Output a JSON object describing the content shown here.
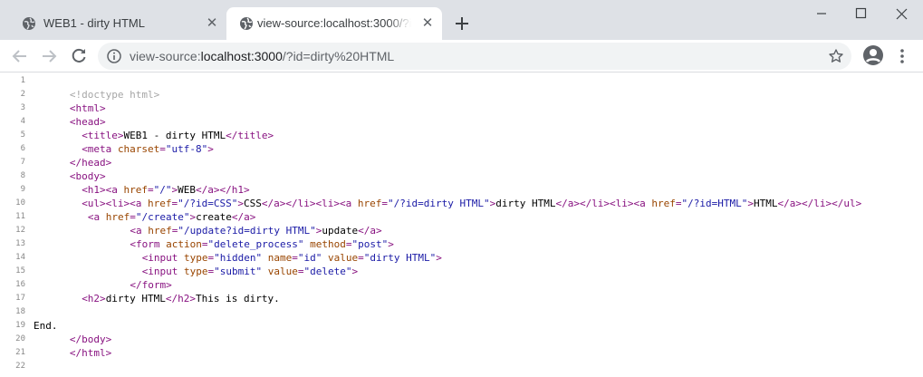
{
  "tabs": [
    {
      "title": "WEB1 - dirty HTML",
      "active": false
    },
    {
      "title": "view-source:localhost:3000/?id=dirty HTML",
      "active": true
    }
  ],
  "url": {
    "scheme": "view-source:",
    "host": "localhost:3000",
    "path": "/?id=dirty%20HTML"
  },
  "source_lines": [
    {
      "num": "1",
      "indent": 0,
      "parts": []
    },
    {
      "num": "2",
      "indent": 6,
      "parts": [
        {
          "t": "comment",
          "v": "<!doctype html>"
        }
      ]
    },
    {
      "num": "3",
      "indent": 6,
      "parts": [
        {
          "t": "tag",
          "v": "<html>"
        }
      ]
    },
    {
      "num": "4",
      "indent": 6,
      "parts": [
        {
          "t": "tag",
          "v": "<head>"
        }
      ]
    },
    {
      "num": "5",
      "indent": 8,
      "parts": [
        {
          "t": "tag",
          "v": "<title>"
        },
        {
          "t": "text",
          "v": "WEB1 - dirty HTML"
        },
        {
          "t": "tag",
          "v": "</title>"
        }
      ]
    },
    {
      "num": "6",
      "indent": 8,
      "parts": [
        {
          "t": "tag",
          "v": "<meta "
        },
        {
          "t": "attr",
          "v": "charset"
        },
        {
          "t": "tag",
          "v": "="
        },
        {
          "t": "val",
          "v": "\"utf-8\""
        },
        {
          "t": "tag",
          "v": ">"
        }
      ]
    },
    {
      "num": "7",
      "indent": 6,
      "parts": [
        {
          "t": "tag",
          "v": "</head>"
        }
      ]
    },
    {
      "num": "8",
      "indent": 6,
      "parts": [
        {
          "t": "tag",
          "v": "<body>"
        }
      ]
    },
    {
      "num": "9",
      "indent": 8,
      "parts": [
        {
          "t": "tag",
          "v": "<h1><a "
        },
        {
          "t": "attr",
          "v": "href"
        },
        {
          "t": "tag",
          "v": "="
        },
        {
          "t": "val",
          "v": "\"/\""
        },
        {
          "t": "tag",
          "v": ">"
        },
        {
          "t": "text",
          "v": "WEB"
        },
        {
          "t": "tag",
          "v": "</a></h1>"
        }
      ]
    },
    {
      "num": "10",
      "indent": 8,
      "parts": [
        {
          "t": "tag",
          "v": "<ul><li><a "
        },
        {
          "t": "attr",
          "v": "href"
        },
        {
          "t": "tag",
          "v": "="
        },
        {
          "t": "val",
          "v": "\"/?id=CSS\""
        },
        {
          "t": "tag",
          "v": ">"
        },
        {
          "t": "text",
          "v": "CSS"
        },
        {
          "t": "tag",
          "v": "</a></li><li><a "
        },
        {
          "t": "attr",
          "v": "href"
        },
        {
          "t": "tag",
          "v": "="
        },
        {
          "t": "val",
          "v": "\"/?id=dirty HTML\""
        },
        {
          "t": "tag",
          "v": ">"
        },
        {
          "t": "text",
          "v": "dirty HTML"
        },
        {
          "t": "tag",
          "v": "</a></li><li><a "
        },
        {
          "t": "attr",
          "v": "href"
        },
        {
          "t": "tag",
          "v": "="
        },
        {
          "t": "val",
          "v": "\"/?id=HTML\""
        },
        {
          "t": "tag",
          "v": ">"
        },
        {
          "t": "text",
          "v": "HTML"
        },
        {
          "t": "tag",
          "v": "</a></li></ul>"
        }
      ]
    },
    {
      "num": "11",
      "indent": 9,
      "parts": [
        {
          "t": "tag",
          "v": "<a "
        },
        {
          "t": "attr",
          "v": "href"
        },
        {
          "t": "tag",
          "v": "="
        },
        {
          "t": "val",
          "v": "\"/create\""
        },
        {
          "t": "tag",
          "v": ">"
        },
        {
          "t": "text",
          "v": "create"
        },
        {
          "t": "tag",
          "v": "</a>"
        }
      ]
    },
    {
      "num": "12",
      "indent": 16,
      "parts": [
        {
          "t": "tag",
          "v": "<a "
        },
        {
          "t": "attr",
          "v": "href"
        },
        {
          "t": "tag",
          "v": "="
        },
        {
          "t": "val",
          "v": "\"/update?id=dirty HTML\""
        },
        {
          "t": "tag",
          "v": ">"
        },
        {
          "t": "text",
          "v": "update"
        },
        {
          "t": "tag",
          "v": "</a>"
        }
      ]
    },
    {
      "num": "13",
      "indent": 16,
      "parts": [
        {
          "t": "tag",
          "v": "<form "
        },
        {
          "t": "attr",
          "v": "action"
        },
        {
          "t": "tag",
          "v": "="
        },
        {
          "t": "val",
          "v": "\"delete_process\""
        },
        {
          "t": "tag",
          "v": " "
        },
        {
          "t": "attr",
          "v": "method"
        },
        {
          "t": "tag",
          "v": "="
        },
        {
          "t": "val",
          "v": "\"post\""
        },
        {
          "t": "tag",
          "v": ">"
        }
      ]
    },
    {
      "num": "14",
      "indent": 18,
      "parts": [
        {
          "t": "tag",
          "v": "<input "
        },
        {
          "t": "attr",
          "v": "type"
        },
        {
          "t": "tag",
          "v": "="
        },
        {
          "t": "val",
          "v": "\"hidden\""
        },
        {
          "t": "tag",
          "v": " "
        },
        {
          "t": "attr",
          "v": "name"
        },
        {
          "t": "tag",
          "v": "="
        },
        {
          "t": "val",
          "v": "\"id\""
        },
        {
          "t": "tag",
          "v": " "
        },
        {
          "t": "attr",
          "v": "value"
        },
        {
          "t": "tag",
          "v": "="
        },
        {
          "t": "val",
          "v": "\"dirty HTML\""
        },
        {
          "t": "tag",
          "v": ">"
        }
      ]
    },
    {
      "num": "15",
      "indent": 18,
      "parts": [
        {
          "t": "tag",
          "v": "<input "
        },
        {
          "t": "attr",
          "v": "type"
        },
        {
          "t": "tag",
          "v": "="
        },
        {
          "t": "val",
          "v": "\"submit\""
        },
        {
          "t": "tag",
          "v": " "
        },
        {
          "t": "attr",
          "v": "value"
        },
        {
          "t": "tag",
          "v": "="
        },
        {
          "t": "val",
          "v": "\"delete\""
        },
        {
          "t": "tag",
          "v": ">"
        }
      ]
    },
    {
      "num": "16",
      "indent": 16,
      "parts": [
        {
          "t": "tag",
          "v": "</form>"
        }
      ]
    },
    {
      "num": "17",
      "indent": 8,
      "parts": [
        {
          "t": "tag",
          "v": "<h2>"
        },
        {
          "t": "text",
          "v": "dirty HTML"
        },
        {
          "t": "tag",
          "v": "</h2>"
        },
        {
          "t": "text",
          "v": "This is dirty."
        }
      ]
    },
    {
      "num": "18",
      "indent": 0,
      "parts": []
    },
    {
      "num": "19",
      "indent": 0,
      "parts": [
        {
          "t": "text",
          "v": "End."
        }
      ]
    },
    {
      "num": "20",
      "indent": 6,
      "parts": [
        {
          "t": "tag",
          "v": "</body>"
        }
      ]
    },
    {
      "num": "21",
      "indent": 6,
      "parts": [
        {
          "t": "tag",
          "v": "</html>"
        }
      ]
    },
    {
      "num": "22",
      "indent": 0,
      "parts": []
    }
  ]
}
